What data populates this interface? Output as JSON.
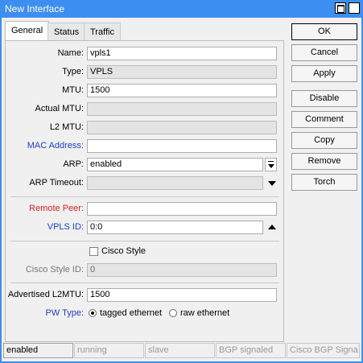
{
  "window": {
    "title": "New Interface"
  },
  "tabs": [
    {
      "label": "General"
    },
    {
      "label": "Status"
    },
    {
      "label": "Traffic"
    }
  ],
  "form": {
    "name": {
      "label": "Name:",
      "value": "vpls1"
    },
    "type": {
      "label": "Type:",
      "value": "VPLS"
    },
    "mtu": {
      "label": "MTU:",
      "value": "1500"
    },
    "actual_mtu": {
      "label": "Actual MTU:",
      "value": ""
    },
    "l2_mtu": {
      "label": "L2 MTU:",
      "value": ""
    },
    "mac_address": {
      "label": "MAC Address:",
      "value": ""
    },
    "arp": {
      "label": "ARP:",
      "value": "enabled"
    },
    "arp_timeout": {
      "label": "ARP Timeout:",
      "value": ""
    },
    "remote_peer": {
      "label": "Remote Peer:",
      "value": ""
    },
    "vpls_id": {
      "label": "VPLS ID:",
      "value": "0:0"
    },
    "cisco_style": {
      "label": "Cisco Style",
      "checked": false
    },
    "cisco_style_id": {
      "label": "Cisco Style ID:",
      "value": "0"
    },
    "advertised_l2mtu": {
      "label": "Advertised L2MTU:",
      "value": "1500"
    },
    "pw_type": {
      "label": "PW Type:",
      "options": [
        "tagged ethernet",
        "raw ethernet"
      ],
      "selected": "tagged ethernet"
    }
  },
  "buttons": {
    "ok": "OK",
    "cancel": "Cancel",
    "apply": "Apply",
    "disable": "Disable",
    "comment": "Comment",
    "copy": "Copy",
    "remove": "Remove",
    "torch": "Torch"
  },
  "status_bar": [
    "enabled",
    "running",
    "slave",
    "BGP signaled",
    "Cisco BGP Signa..."
  ],
  "colors": {
    "titlebar": "#3c8ff0",
    "label_blue": "#1f3fbf",
    "label_red": "#d62020"
  }
}
